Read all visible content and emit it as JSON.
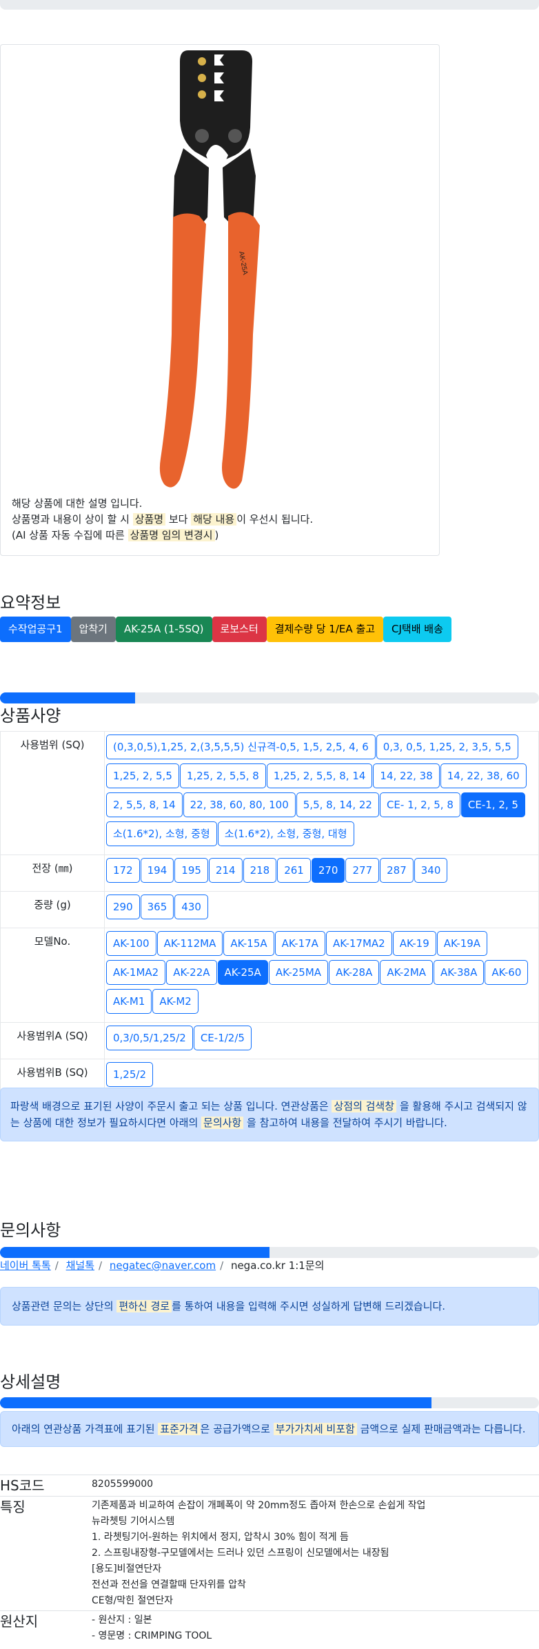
{
  "product": {
    "image_alt": "AK-25A 압착기 (orange handle crimping tool)",
    "model_print": "AK-25A",
    "desc_line1": "해당 상품에 대한 설명 입니다.",
    "desc_line2_a": "상품명과 내용이 상이 할 시",
    "desc_line2_mark1": "상품명",
    "desc_line2_b": "보다",
    "desc_line2_mark2": "해당 내용",
    "desc_line2_c": "이 우선시 됩니다.",
    "desc_line3_a": "(AI 상품 자동 수집에 따른",
    "desc_line3_mark": "상품명 임의 변경시",
    "desc_line3_b": ")"
  },
  "summary": {
    "title": "요약정보",
    "tags": [
      "수작업공구1",
      "압착기",
      "AK-25A (1-5SQ)",
      "로보스터",
      "결제수량 당 1/EA 출고",
      "CJ택배 배송"
    ]
  },
  "spec": {
    "title": "상품사양",
    "progress_percent": 25,
    "rows": [
      {
        "label": "사용범위 (SQ)",
        "options": [
          "(0,3,0,5),1,25, 2,(3,5,5,5) 신규격-0,5, 1,5, 2,5, 4, 6",
          "0,3, 0,5, 1,25, 2, 3,5, 5,5",
          "1,25, 2, 5,5",
          "1,25, 2, 5,5, 8",
          "1,25, 2, 5,5, 8, 14",
          "14, 22, 38",
          "14, 22, 38, 60",
          "2, 5,5, 8, 14",
          "22, 38, 60, 80, 100",
          "5,5, 8, 14, 22",
          "CE- 1, 2, 5, 8",
          "CE-1, 2, 5",
          "소(1.6*2), 소형, 중형",
          "소(1.6*2), 소형, 중형, 대형"
        ],
        "active": 11
      },
      {
        "label": "전장 (㎜)",
        "options": [
          "172",
          "194",
          "195",
          "214",
          "218",
          "261",
          "270",
          "277",
          "287",
          "340"
        ],
        "active": 6
      },
      {
        "label": "중량 (g)",
        "options": [
          "290",
          "365",
          "430"
        ],
        "active": -1
      },
      {
        "label": "모델No.",
        "options": [
          "AK-100",
          "AK-112MA",
          "AK-15A",
          "AK-17A",
          "AK-17MA2",
          "AK-19",
          "AK-19A",
          "AK-1MA2",
          "AK-22A",
          "AK-25A",
          "AK-25MA",
          "AK-28A",
          "AK-2MA",
          "AK-38A",
          "AK-60",
          "AK-M1",
          "AK-M2"
        ],
        "active": 9
      },
      {
        "label": "사용범위A (SQ)",
        "options": [
          "0,3/0,5/1,25/2",
          "CE-1/2/5"
        ],
        "active": -1
      },
      {
        "label": "사용범위B (SQ)",
        "options": [
          "1,25/2"
        ],
        "active": -1
      }
    ],
    "notice_a": "파랑색 배경으로 표기된 사양이 주문시 출고 되는 상품 입니다. 연관상품은",
    "notice_mark1": "상점의 검색창",
    "notice_b": "을 활용해 주시고 검색되지 않는 상품에 대한 정보가 필요하시다면 아래의",
    "notice_mark2": "문의사항",
    "notice_c": "을 참고하여 내용을 전달하여 주시기 바랍니다."
  },
  "inquiry": {
    "title": "문의사항",
    "progress_percent": 50,
    "links": [
      "네이버 톡톡",
      "채널톡",
      "negatec@naver.com"
    ],
    "plain": "nega.co.kr 1:1문의",
    "notice_a": "상품관련 문의는 상단의",
    "notice_mark": "편하신 경로",
    "notice_b": "를 통하여 내용을 입력해 주시면 성실하게 답변해 드리겠습니다."
  },
  "detail": {
    "title": "상세설명",
    "progress_percent": 80,
    "notice_a": "아래의 연관상품 가격표에 표기된",
    "notice_mark1": "표준가격",
    "notice_b": "은 공급가액으로",
    "notice_mark2": "부가가치세 비포함",
    "notice_c": "금액으로 실제 판매금액과는 다릅니다.",
    "hs_label": "HS코드",
    "hs_value": "8205599000",
    "feature_label": "특징",
    "features": [
      "기존제품과 비교하여 손잡이 개폐폭이 약 20mm정도 좁아져 한손으로 손쉽게 작업",
      "뉴라쳇팅 기어시스템",
      "1. 라쳇팅기어-원하는 위치에서 정지, 압착시 30% 힘이 적게 듬",
      "2. 스프링내장형-구모델에서는 드러나 있던 스프링이 신모델에서는 내장됨",
      "[용도]비절연단자",
      "전선과 전선을 연결할때 단자위를 압착",
      "CE형/막힌 절연단자"
    ],
    "origin_label": "원산지",
    "origin": [
      "- 원산지 : 일본",
      "- 영문명 : CRIMPING TOOL"
    ]
  },
  "colors": {
    "primary": "#0d6efd",
    "handle": "#e8632d",
    "alert_bg": "#cfe2ff",
    "mark_bg": "#fcf3cf"
  }
}
